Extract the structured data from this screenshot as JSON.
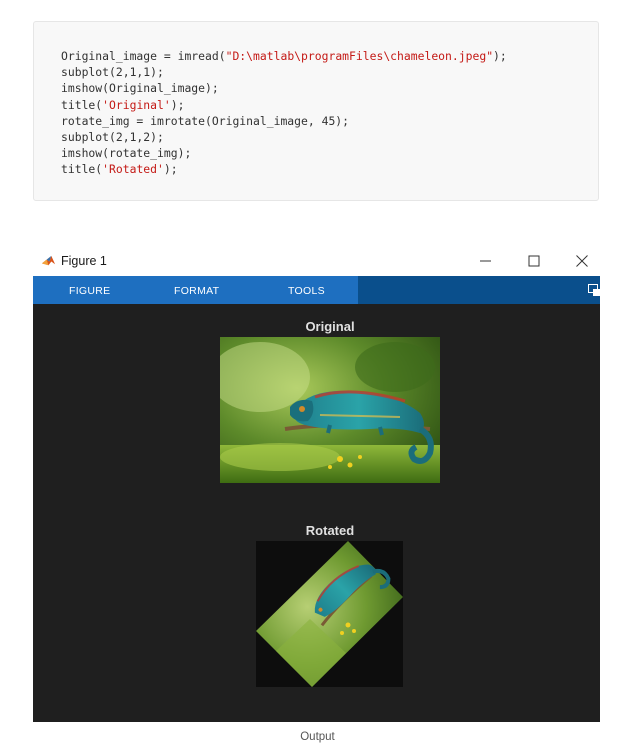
{
  "code": {
    "lines": [
      [
        {
          "t": "Original_image = imread(",
          "c": ""
        },
        {
          "t": "\"D:\\matlab\\programFiles\\chameleon.jpeg\"",
          "c": "str"
        },
        {
          "t": ");",
          "c": ""
        }
      ],
      [
        {
          "t": "subplot(2,1,1);",
          "c": ""
        }
      ],
      [
        {
          "t": "imshow(Original_image);",
          "c": ""
        }
      ],
      [
        {
          "t": "title(",
          "c": ""
        },
        {
          "t": "'Original'",
          "c": "str"
        },
        {
          "t": ");",
          "c": ""
        }
      ],
      [
        {
          "t": "rotate_img = imrotate(Original_image, 45);",
          "c": ""
        }
      ],
      [
        {
          "t": "subplot(2,1,2);",
          "c": ""
        }
      ],
      [
        {
          "t": "imshow(rotate_img);",
          "c": ""
        }
      ],
      [
        {
          "t": "title(",
          "c": ""
        },
        {
          "t": "'Rotated'",
          "c": "str"
        },
        {
          "t": ");",
          "c": ""
        }
      ]
    ]
  },
  "figure": {
    "window_title": "Figure 1",
    "tabs": [
      "FIGURE",
      "FORMAT",
      "TOOLS"
    ],
    "axes": [
      {
        "title": "Original"
      },
      {
        "title": "Rotated"
      }
    ]
  },
  "caption": "Output",
  "colors": {
    "figure_bg": "#1f1f1f",
    "toolstrip": "#0a4f8c",
    "tab_area": "#1e6fc0",
    "string_literal": "#c41a16"
  }
}
